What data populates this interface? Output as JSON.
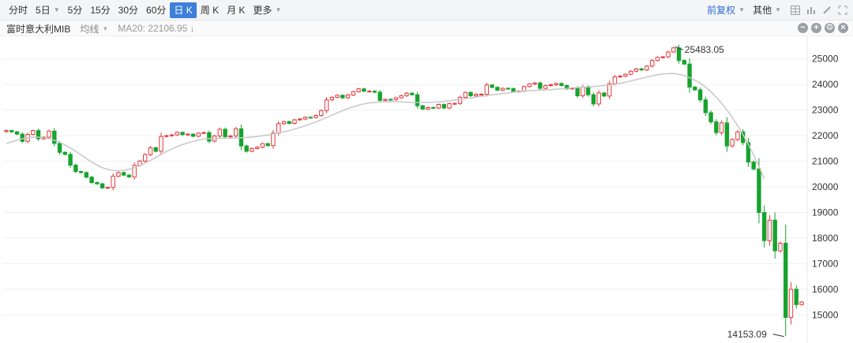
{
  "toolbar": {
    "periods": [
      {
        "label": "分时",
        "dropdown": false,
        "active": false
      },
      {
        "label": "5日",
        "dropdown": true,
        "active": false
      },
      {
        "label": "5分",
        "dropdown": false,
        "active": false
      },
      {
        "label": "15分",
        "dropdown": false,
        "active": false
      },
      {
        "label": "30分",
        "dropdown": false,
        "active": false
      },
      {
        "label": "60分",
        "dropdown": false,
        "active": false
      },
      {
        "label": "日 K",
        "dropdown": false,
        "active": true
      },
      {
        "label": "周 K",
        "dropdown": false,
        "active": false
      },
      {
        "label": "月 K",
        "dropdown": false,
        "active": false
      },
      {
        "label": "更多",
        "dropdown": true,
        "active": false
      }
    ],
    "adjust_label": "前复权",
    "other_label": "其他",
    "right_icons": [
      "grid-icon",
      "bars-icon",
      "pen-icon",
      "fullscreen-icon"
    ]
  },
  "infobar": {
    "symbol_name": "富时意大利MIB",
    "chart_type_label": "均线",
    "ma_label": "MA20: 22106.95 ↓",
    "right_icons": [
      "minus-icon",
      "plus-icon",
      "settings-icon",
      "close-icon"
    ]
  },
  "colors": {
    "up": "#e4393c",
    "down": "#17a32e",
    "ma": "#c8c8c8",
    "grid": "#eef0f2",
    "accent": "#3d7fd9"
  },
  "chart_data": {
    "type": "candlestick",
    "title": "富时意大利MIB",
    "ylim": [
      13900,
      25700
    ],
    "yticks": [
      15000,
      16000,
      17000,
      18000,
      19000,
      20000,
      21000,
      22000,
      23000,
      24000,
      25000
    ],
    "annotations": {
      "max_label": "25483.05",
      "min_label": "14153.09",
      "max_value": 25483.05,
      "min_value": 14153.09
    },
    "closes": [
      22200,
      22150,
      22060,
      21780,
      22050,
      22200,
      21880,
      21940,
      22180,
      21700,
      21350,
      21270,
      20850,
      20600,
      20560,
      20380,
      20170,
      20120,
      19960,
      19980,
      20420,
      20560,
      20460,
      20390,
      20840,
      21010,
      21260,
      21530,
      21390,
      21970,
      22000,
      22030,
      22130,
      22040,
      22060,
      21980,
      22100,
      22120,
      21790,
      21990,
      22250,
      21960,
      21990,
      22270,
      21600,
      21390,
      21500,
      21550,
      21690,
      21610,
      22100,
      22470,
      22550,
      22480,
      22620,
      22650,
      22720,
      22710,
      22790,
      22980,
      23400,
      23500,
      23580,
      23480,
      23590,
      23720,
      23830,
      23740,
      23740,
      23700,
      23380,
      23420,
      23410,
      23480,
      23560,
      23660,
      23600,
      23170,
      23040,
      23100,
      23080,
      23220,
      23080,
      23250,
      23260,
      23500,
      23690,
      23560,
      23620,
      23620,
      23980,
      23890,
      23780,
      23850,
      23840,
      23720,
      23740,
      23920,
      24020,
      24060,
      23850,
      23960,
      23990,
      24040,
      23960,
      23830,
      23860,
      23560,
      23900,
      23600,
      23240,
      23670,
      23550,
      24030,
      24300,
      24330,
      24400,
      24520,
      24610,
      24570,
      24720,
      24940,
      25060,
      25080,
      25270,
      25430,
      24940,
      24800,
      23900,
      23790,
      23400,
      22900,
      22540,
      22120,
      22500,
      21600,
      21850,
      22150,
      21730,
      20970,
      20700,
      19000,
      17900,
      18700,
      17500,
      17800,
      14900,
      16000,
      15400,
      15500
    ],
    "ma20": [
      21700,
      21760,
      21820,
      21880,
      21920,
      21940,
      21940,
      21920,
      21880,
      21820,
      21740,
      21640,
      21520,
      21390,
      21250,
      21110,
      20970,
      20850,
      20750,
      20680,
      20640,
      20630,
      20650,
      20690,
      20750,
      20830,
      20930,
      21040,
      21150,
      21270,
      21380,
      21480,
      21570,
      21650,
      21720,
      21780,
      21830,
      21870,
      21890,
      21900,
      21900,
      21900,
      21900,
      21910,
      21920,
      21930,
      21950,
      21970,
      22000,
      22030,
      22070,
      22110,
      22150,
      22200,
      22260,
      22320,
      22390,
      22460,
      22540,
      22620,
      22710,
      22800,
      22890,
      22980,
      23060,
      23130,
      23190,
      23240,
      23280,
      23300,
      23320,
      23330,
      23330,
      23330,
      23320,
      23310,
      23300,
      23300,
      23300,
      23300,
      23310,
      23320,
      23340,
      23360,
      23390,
      23420,
      23450,
      23480,
      23510,
      23540,
      23570,
      23600,
      23620,
      23650,
      23670,
      23700,
      23720,
      23740,
      23760,
      23770,
      23780,
      23790,
      23800,
      23820,
      23830,
      23850,
      23870,
      23880,
      23900,
      23910,
      23920,
      23940,
      23960,
      23980,
      24010,
      24050,
      24090,
      24140,
      24190,
      24240,
      24290,
      24340,
      24380,
      24410,
      24430,
      24430,
      24400,
      24350,
      24270,
      24170,
      24050,
      23900,
      23720,
      23510,
      23270,
      23000,
      22710,
      22390,
      22040,
      21660,
      21250,
      20800,
      20320
    ]
  }
}
